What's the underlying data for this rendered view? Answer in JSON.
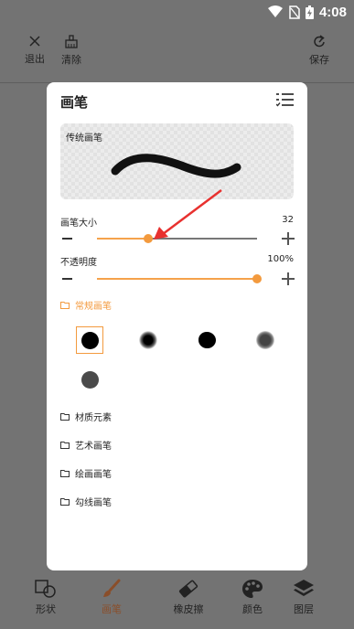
{
  "status_bar": {
    "time": "4:08"
  },
  "top_toolbar": {
    "exit_label": "退出",
    "clear_label": "清除",
    "save_label": "保存"
  },
  "panel": {
    "title": "画笔",
    "preview_label": "传统画笔",
    "size": {
      "label": "画笔大小",
      "value": "32",
      "fraction": 0.32
    },
    "opacity": {
      "label": "不透明度",
      "value": "100%",
      "fraction": 1.0
    },
    "categories": {
      "regular": "常规画笔",
      "texture": "材质元素",
      "art": "艺术画笔",
      "painting": "绘画画笔",
      "outline": "勾线画笔"
    },
    "brushes": [
      "hard-round",
      "soft-blur",
      "ink-round",
      "soft-grey",
      "grey-round"
    ],
    "selected_brush_index": 0
  },
  "bottom_tabs": {
    "shape": "形状",
    "brush": "画笔",
    "eraser": "橡皮擦",
    "color": "颜色",
    "layer": "图层"
  },
  "colors": {
    "accent": "#f39a3e",
    "overlay": "#737373",
    "annotation_arrow": "#e8312f"
  }
}
